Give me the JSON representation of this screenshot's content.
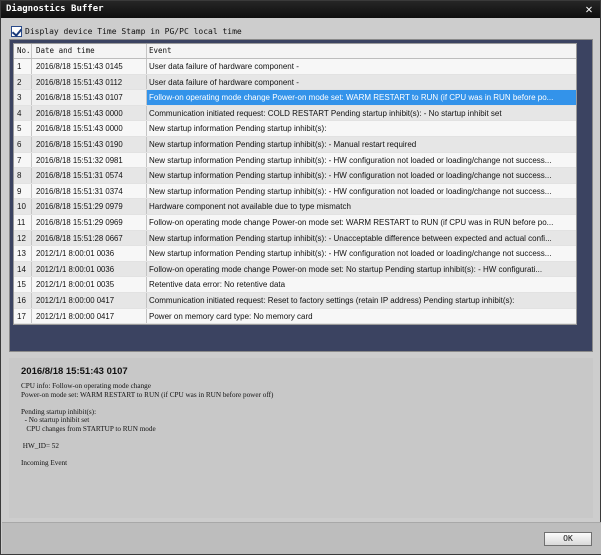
{
  "window": {
    "title": "Diagnostics Buffer",
    "close_icon": "✕"
  },
  "options": {
    "timestamp_label": "Display device Time Stamp in PG/PC local time",
    "timestamp_checked": true
  },
  "table": {
    "headers": {
      "no": "No.",
      "date": "Date and time",
      "event": "Event"
    },
    "rows": [
      {
        "no": "1",
        "date": "2016/8/18 15:51:43 0145",
        "event": "User data failure of hardware component -"
      },
      {
        "no": "2",
        "date": "2016/8/18 15:51:43 0112",
        "event": "User data failure of hardware component -"
      },
      {
        "no": "3",
        "date": "2016/8/18 15:51:43 0107",
        "event": "Follow-on operating mode change  Power-on mode set: WARM RESTART to RUN (if CPU was in RUN before po..."
      },
      {
        "no": "4",
        "date": "2016/8/18 15:51:43 0000",
        "event": "Communication initiated request: COLD RESTART  Pending startup inhibit(s):  - No startup inhibit set"
      },
      {
        "no": "5",
        "date": "2016/8/18 15:51:43 0000",
        "event": "New startup information  Pending startup inhibit(s):"
      },
      {
        "no": "6",
        "date": "2016/8/18 15:51:43 0190",
        "event": "New startup information  Pending startup inhibit(s):  - Manual restart required"
      },
      {
        "no": "7",
        "date": "2016/8/18 15:51:32 0981",
        "event": "New startup information  Pending startup inhibit(s):  - HW configuration not loaded or loading/change not success..."
      },
      {
        "no": "8",
        "date": "2016/8/18 15:51:31 0574",
        "event": "New startup information  Pending startup inhibit(s):  - HW configuration not loaded or loading/change not success..."
      },
      {
        "no": "9",
        "date": "2016/8/18 15:51:31 0374",
        "event": "New startup information  Pending startup inhibit(s):  - HW configuration not loaded or loading/change not success..."
      },
      {
        "no": "10",
        "date": "2016/8/18 15:51:29 0979",
        "event": "Hardware component not available due to type mismatch"
      },
      {
        "no": "11",
        "date": "2016/8/18 15:51:29 0969",
        "event": "Follow-on operating mode change  Power-on mode set: WARM RESTART to RUN (if CPU was in RUN before po..."
      },
      {
        "no": "12",
        "date": "2016/8/18 15:51:28 0667",
        "event": "New startup information  Pending startup inhibit(s):  - Unacceptable difference between expected and actual confi..."
      },
      {
        "no": "13",
        "date": "2012/1/1 8:00:01 0036",
        "event": "New startup information  Pending startup inhibit(s):  - HW configuration not loaded or loading/change not success..."
      },
      {
        "no": "14",
        "date": "2012/1/1 8:00:01 0036",
        "event": "Follow-on operating mode change  Power-on mode set: No startup    Pending startup inhibit(s):  - HW configurati..."
      },
      {
        "no": "15",
        "date": "2012/1/1 8:00:01 0035",
        "event": "Retentive data error: No retentive data"
      },
      {
        "no": "16",
        "date": "2012/1/1 8:00:00 0417",
        "event": "Communication initiated request: Reset to factory settings (retain IP address)  Pending startup inhibit(s):"
      },
      {
        "no": "17",
        "date": "2012/1/1 8:00:00 0417",
        "event": "Power on    memory card type: No memory card"
      }
    ],
    "selected_row": 3
  },
  "detail": {
    "title": "2016/8/18 15:51:43  0107",
    "lines": [
      "CPU info: Follow-on operating mode change",
      "Power-on mode set: WARM RESTART to RUN (if CPU was in RUN before power off)",
      "",
      "Pending startup inhibit(s):",
      "  - No startup inhibit set",
      "   CPU changes from STARTUP to RUN mode",
      "",
      " HW_ID= 52",
      "",
      "Incoming Event"
    ]
  },
  "footer": {
    "ok_label": "OK"
  }
}
